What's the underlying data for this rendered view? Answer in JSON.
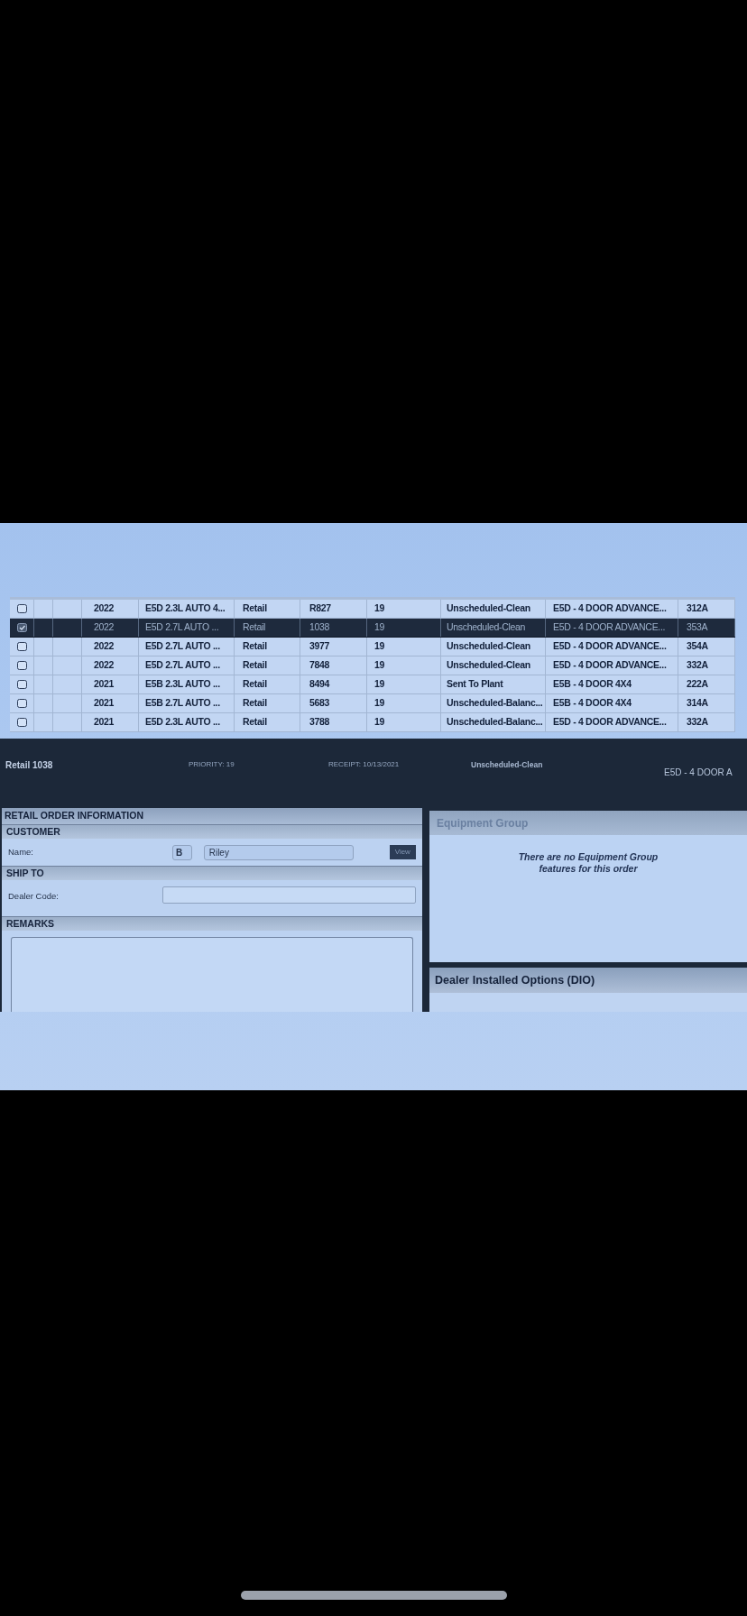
{
  "order_table": {
    "rows": [
      {
        "selected": false,
        "checked": false,
        "cells": [
          "2022",
          "E5D 2.3L AUTO 4...",
          "Retail",
          "R827",
          "19",
          "Unscheduled-Clean",
          "E5D - 4 DOOR ADVANCE...",
          "312A"
        ]
      },
      {
        "selected": true,
        "checked": true,
        "cells": [
          "2022",
          "E5D 2.7L AUTO ...",
          "Retail",
          "1038",
          "19",
          "Unscheduled-Clean",
          "E5D - 4 DOOR ADVANCE...",
          "353A"
        ]
      },
      {
        "selected": false,
        "checked": false,
        "cells": [
          "2022",
          "E5D 2.7L AUTO ...",
          "Retail",
          "3977",
          "19",
          "Unscheduled-Clean",
          "E5D - 4 DOOR ADVANCE...",
          "354A"
        ]
      },
      {
        "selected": false,
        "checked": false,
        "cells": [
          "2022",
          "E5D 2.7L AUTO ...",
          "Retail",
          "7848",
          "19",
          "Unscheduled-Clean",
          "E5D - 4 DOOR ADVANCE...",
          "332A"
        ]
      },
      {
        "selected": false,
        "checked": false,
        "cells": [
          "2021",
          "E5B 2.3L AUTO ...",
          "Retail",
          "8494",
          "19",
          "Sent To Plant",
          "E5B - 4 DOOR 4X4",
          "222A"
        ]
      },
      {
        "selected": false,
        "checked": false,
        "cells": [
          "2021",
          "E5B 2.7L AUTO ...",
          "Retail",
          "5683",
          "19",
          "Unscheduled-Balanc...",
          "E5B - 4 DOOR 4X4",
          "314A"
        ]
      },
      {
        "selected": false,
        "checked": false,
        "cells": [
          "2021",
          "E5D 2.3L AUTO ...",
          "Retail",
          "3788",
          "19",
          "Unscheduled-Balanc...",
          "E5D - 4 DOOR ADVANCE...",
          "332A"
        ]
      }
    ]
  },
  "selected_order_bar": {
    "order": "Retail 1038",
    "priority": "PRIORITY: 19",
    "receipt": "RECEIPT: 10/13/2021",
    "status": "Unscheduled-Clean",
    "description": "E5D - 4 DOOR A"
  },
  "retail_order_information": {
    "title": "RETAIL ORDER INFORMATION",
    "sections": [
      {
        "kind": "customer",
        "title": "CUSTOMER",
        "label": "Name:",
        "initial": "B",
        "last_name": "Riley",
        "button": "View"
      },
      {
        "kind": "ship_to",
        "title": "SHIP TO",
        "label": "Dealer Code:"
      },
      {
        "kind": "remarks",
        "title": "REMARKS"
      }
    ]
  },
  "equipment_group": {
    "title": "Equipment Group",
    "message": "There are no Equipment Group features for this order"
  },
  "dealer_installed_options": {
    "title": "Dealer Installed Options (DIO)"
  }
}
